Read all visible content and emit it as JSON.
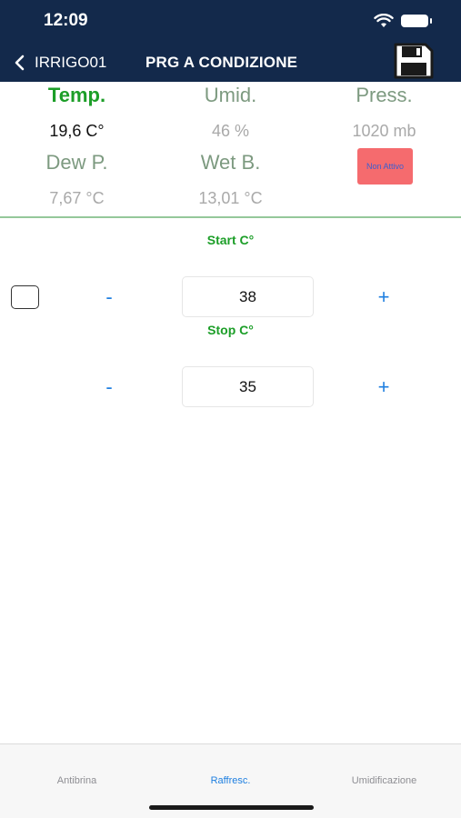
{
  "status_bar": {
    "time": "12:09",
    "wifi_icon": "wifi-icon",
    "battery_icon": "battery-icon"
  },
  "nav": {
    "back_label": "IRRIGO01",
    "title": "PRG A CONDIZIONE",
    "save_icon": "floppy-disk-icon"
  },
  "readings": {
    "temp": {
      "label": "Temp.",
      "value": "19,6 C°"
    },
    "umid": {
      "label": "Umid.",
      "value": "46 %"
    },
    "press": {
      "label": "Press.",
      "value": "1020 mb"
    },
    "dew": {
      "label": "Dew P.",
      "value": "7,67 °C"
    },
    "wet": {
      "label": "Wet B.",
      "value": "13,01 °C"
    },
    "status": "Non Attivo"
  },
  "start": {
    "label": "Start C°",
    "value": "38",
    "minus": "-",
    "plus": "+"
  },
  "stop": {
    "label": "Stop C°",
    "value": "35",
    "minus": "-",
    "plus": "+"
  },
  "tabs": [
    {
      "label": "Antibrina"
    },
    {
      "label": "Raffresc."
    },
    {
      "label": "Umidificazione"
    }
  ],
  "colors": {
    "header": "#13294b",
    "accent_green": "#1c9e28",
    "accent_blue": "#1e7fe0",
    "badge_red": "#f56b6e"
  }
}
